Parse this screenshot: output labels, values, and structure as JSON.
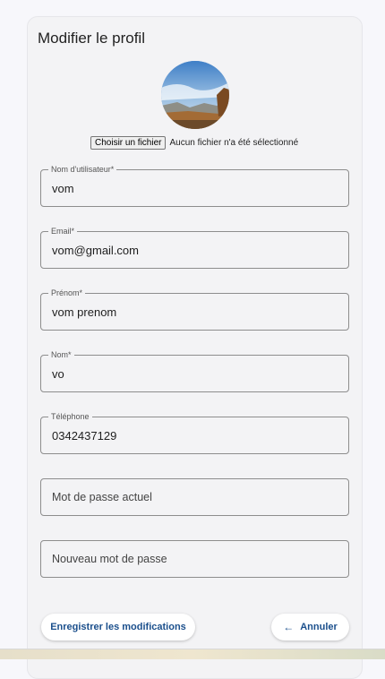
{
  "form": {
    "title": "Modifier le profil",
    "file_button": "Choisir un fichier",
    "file_status": "Aucun fichier n'a été sélectionné",
    "fields": {
      "username": {
        "label": "Nom d'utilisateur*",
        "value": "vom"
      },
      "email": {
        "label": "Email*",
        "value": "vom@gmail.com"
      },
      "firstname": {
        "label": "Prénom*",
        "value": "vom prenom"
      },
      "lastname": {
        "label": "Nom*",
        "value": "vo"
      },
      "phone": {
        "label": "Téléphone",
        "value": "0342437129"
      },
      "current_password": {
        "placeholder": "Mot de passe actuel"
      },
      "new_password": {
        "placeholder": "Nouveau mot de passe"
      }
    },
    "actions": {
      "save_label": "Enregistrer les modifications",
      "cancel_label": "Annuler",
      "cancel_icon": "arrow-left-icon"
    }
  },
  "colors": {
    "accent": "#1b4f8c",
    "card_background": "#f3f3f5",
    "page_background": "#f7f7fb"
  }
}
